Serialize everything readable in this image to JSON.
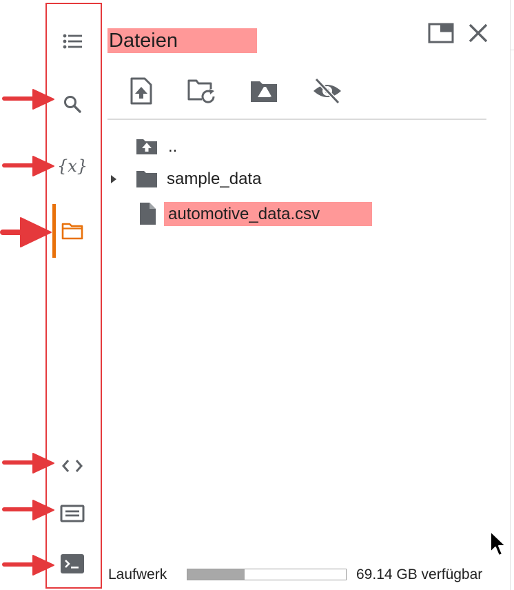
{
  "panel": {
    "title": "Dateien"
  },
  "sidebar": {
    "items": [
      {
        "name": "table-of-contents",
        "icon": "list-icon"
      },
      {
        "name": "search",
        "icon": "search-icon"
      },
      {
        "name": "variables",
        "icon": "variables-icon",
        "label": "{x}"
      },
      {
        "name": "files",
        "icon": "folder-icon",
        "active": true
      },
      {
        "name": "code-snippets",
        "icon": "code-icon"
      },
      {
        "name": "command-palette",
        "icon": "keyboard-icon"
      },
      {
        "name": "terminal",
        "icon": "terminal-icon"
      }
    ]
  },
  "toolbar": {
    "buttons": [
      {
        "icon": "upload-file-icon"
      },
      {
        "icon": "refresh-folder-icon"
      },
      {
        "icon": "mount-drive-icon"
      },
      {
        "icon": "hide-hidden-files-icon"
      }
    ]
  },
  "files": {
    "parent": {
      "label": ".."
    },
    "items": [
      {
        "label": "sample_data",
        "type": "folder",
        "expandable": true
      },
      {
        "label": "automotive_data.csv",
        "type": "file",
        "highlighted": true
      }
    ]
  },
  "footer": {
    "disk_label": "Laufwerk",
    "available_text": "69.14 GB verfügbar",
    "usage_fraction": 0.36
  },
  "colors": {
    "annotation_red": "#e5393c",
    "highlight_pink": "#ff9898",
    "active_orange": "#e8710a",
    "icon_gray": "#5f6368"
  }
}
